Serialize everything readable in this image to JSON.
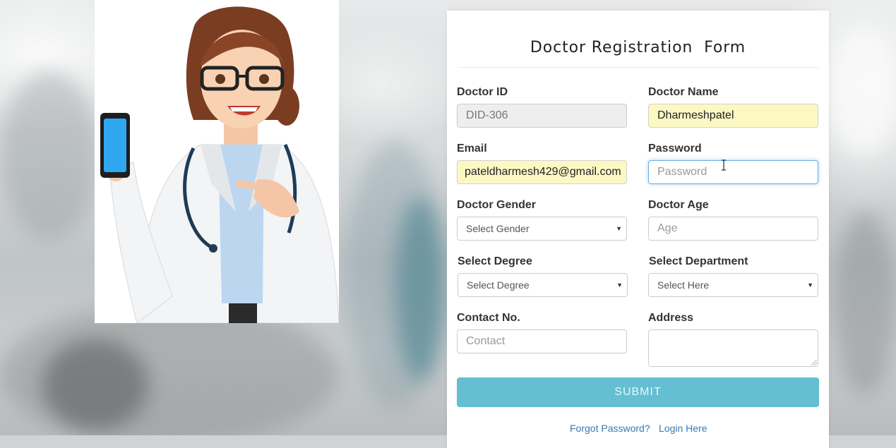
{
  "form": {
    "title": "Doctor Registration  Form",
    "doctor_id": {
      "label": "Doctor ID",
      "value": "DID-306"
    },
    "doctor_name": {
      "label": "Doctor Name",
      "value": "Dharmeshpatel"
    },
    "email": {
      "label": "Email",
      "value": "pateldharmesh429@gmail.com"
    },
    "password": {
      "label": "Password",
      "placeholder": "Password"
    },
    "gender": {
      "label": "Doctor Gender",
      "selected": "Select Gender"
    },
    "age": {
      "label": "Doctor Age",
      "placeholder": "Age"
    },
    "degree": {
      "label": "Select Degree",
      "selected": "Select Degree"
    },
    "department": {
      "label": "Select Department",
      "selected": "Select Here"
    },
    "contact": {
      "label": "Contact No.",
      "placeholder": "Contact"
    },
    "address": {
      "label": "Address",
      "value": ""
    },
    "submit_label": "SUBMIT",
    "forgot_password": "Forgot Password?",
    "login_here": "Login Here"
  },
  "colors": {
    "submit": "#5bbccf",
    "autofill": "#fbf8c4",
    "focus": "#66afe9",
    "link": "#337ab7"
  },
  "icons": [
    "dropdown-caret-icon",
    "text-cursor-icon",
    "doctor-illustration"
  ]
}
